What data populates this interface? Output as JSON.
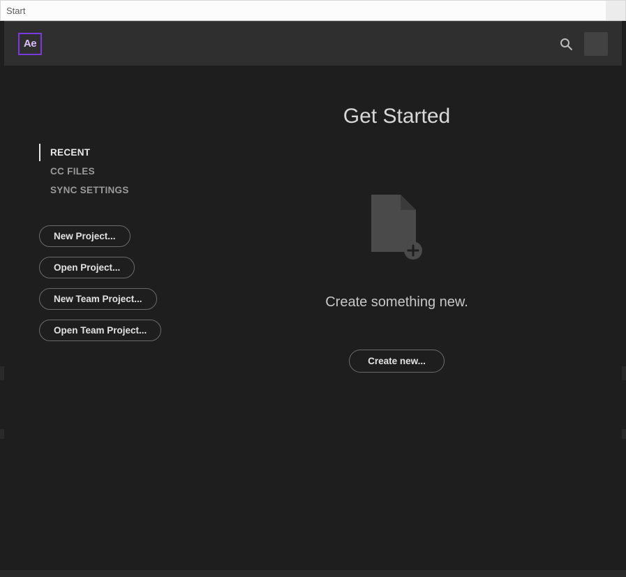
{
  "titlebar": {
    "title": "Start"
  },
  "app": {
    "logo_text": "Ae"
  },
  "nav": {
    "items": [
      {
        "label": "RECENT",
        "active": true
      },
      {
        "label": "CC FILES",
        "active": false
      },
      {
        "label": "SYNC SETTINGS",
        "active": false
      }
    ]
  },
  "side_buttons": [
    {
      "label": "New Project..."
    },
    {
      "label": "Open Project..."
    },
    {
      "label": "New Team Project..."
    },
    {
      "label": "Open Team Project..."
    }
  ],
  "main": {
    "title": "Get Started",
    "subtitle": "Create something new.",
    "create_label": "Create new..."
  },
  "icons": {
    "search": "search-icon",
    "document_plus": "document-plus-icon"
  },
  "colors": {
    "accent": "#7b3bdb",
    "bg_dark": "#1e1e1e",
    "bg_bar": "#2f2f2f",
    "text_light": "#e2e2e2",
    "text_muted": "#9a9a9a"
  }
}
